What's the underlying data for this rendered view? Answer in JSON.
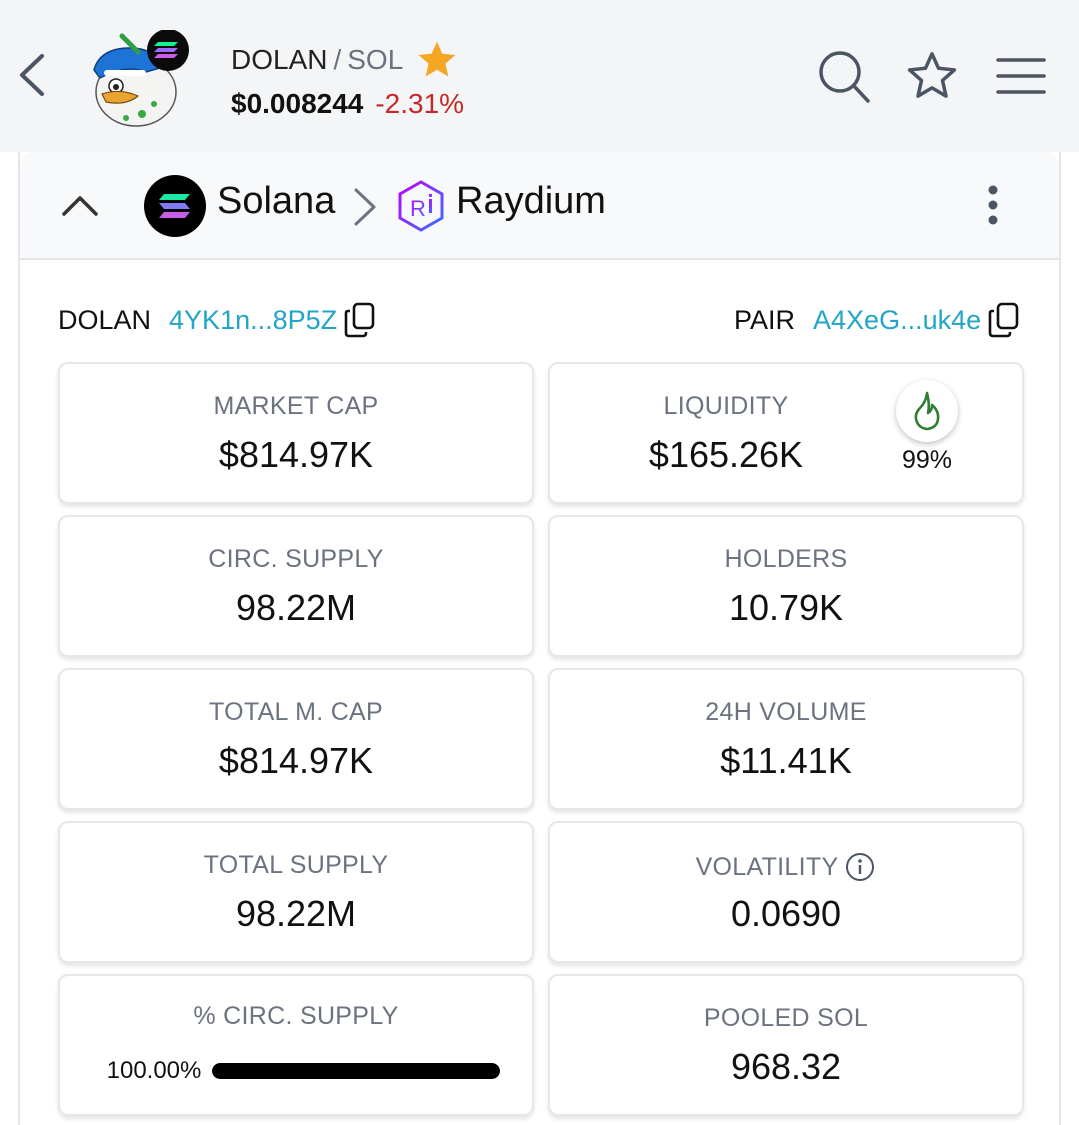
{
  "header": {
    "token_symbol": "DOLAN",
    "separator": "/",
    "quote_symbol": "SOL",
    "price": "$0.008244",
    "price_change": "-2.31%",
    "icons": [
      "back-chevron-icon",
      "token-avatar-icon",
      "favorite-star-icon",
      "search-icon",
      "watchlist-star-icon",
      "menu-icon"
    ]
  },
  "chain_bar": {
    "chain_name": "Solana",
    "dex_name": "Raydium",
    "icons": [
      "collapse-chevron-icon",
      "solana-logo-icon",
      "chevron-right-icon",
      "raydium-logo-icon",
      "more-vertical-icon"
    ]
  },
  "addresses": {
    "token_label": "DOLAN",
    "token_address": "4YK1n...8P5Z",
    "pair_label": "PAIR",
    "pair_address": "A4XeG...uk4e"
  },
  "metrics": {
    "market_cap": {
      "label": "MARKET CAP",
      "value": "$814.97K"
    },
    "liquidity": {
      "label": "LIQUIDITY",
      "value": "$165.26K",
      "burn_percent": "99%",
      "badge_icon": "flame-icon"
    },
    "circ_supply": {
      "label": "CIRC. SUPPLY",
      "value": "98.22M"
    },
    "holders": {
      "label": "HOLDERS",
      "value": "10.79K"
    },
    "total_mcap": {
      "label": "TOTAL M. CAP",
      "value": "$814.97K"
    },
    "volume_24h": {
      "label": "24H VOLUME",
      "value": "$11.41K"
    },
    "total_supply": {
      "label": "TOTAL SUPPLY",
      "value": "98.22M"
    },
    "volatility": {
      "label": "VOLATILITY",
      "value": "0.0690"
    },
    "pct_circ_supply": {
      "label": "% CIRC. SUPPLY",
      "value_text": "100.00%",
      "fraction": 1.0
    },
    "pooled_sol": {
      "label": "POOLED SOL",
      "value": "968.32"
    }
  },
  "colors": {
    "accent_link": "#22a5c6",
    "negative": "#c62828",
    "favorite_star": "#f5a623",
    "flame": "#2e7d32"
  }
}
